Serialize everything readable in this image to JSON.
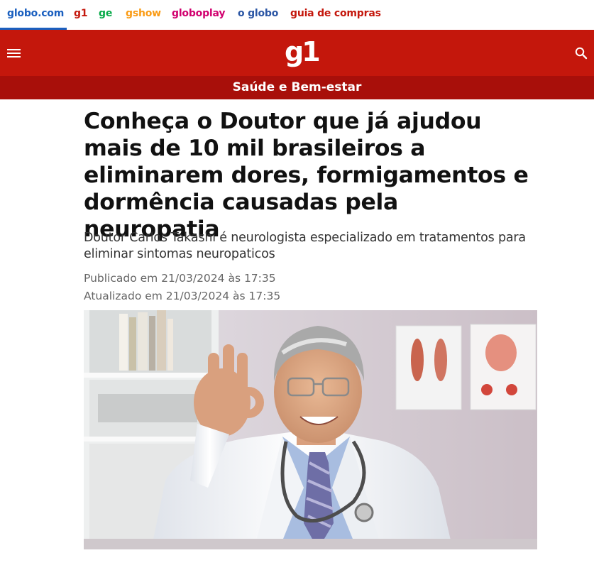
{
  "topnav": {
    "items": [
      "globo.com",
      "g1",
      "ge",
      "gshow",
      "globoplay",
      "o globo",
      "guia de compras"
    ]
  },
  "header": {
    "logo": "g1",
    "menu_icon": "hamburger-menu-icon",
    "search_icon": "search-icon",
    "bg_color": "#c4170c"
  },
  "section": {
    "label": "Saúde e Bem-estar",
    "bg_color": "#a80f0a"
  },
  "article": {
    "headline": "Conheça o Doutor que já ajudou mais de 10 mil brasileiros a eliminarem dores, formigamentos e dormência causadas pela neuropatia",
    "subtitle": "Doutor Carlos Takashi é neurologista especializado em tratamentos para eliminar sintomas neuropaticos",
    "published": "Publicado em 21/03/2024 às 17:35",
    "updated": "Atualizado em 21/03/2024 às 17:35"
  }
}
